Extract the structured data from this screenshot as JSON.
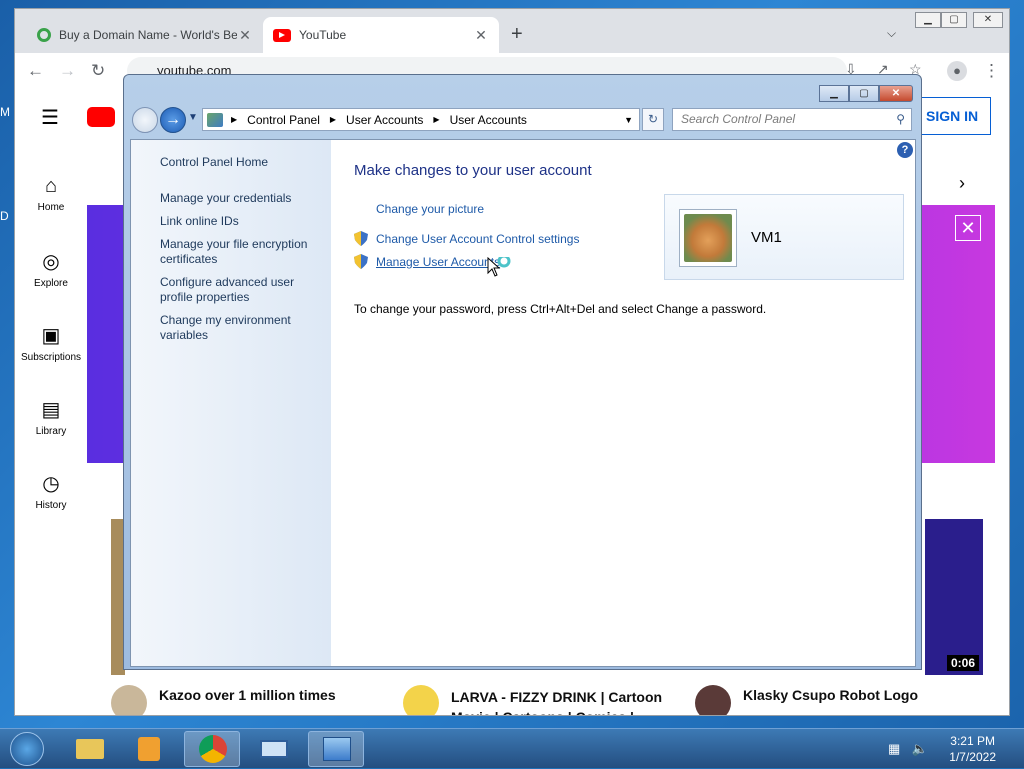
{
  "desktop": {
    "edge_letters": [
      "M",
      "D"
    ]
  },
  "browser": {
    "tabs": [
      {
        "title": "Buy a Domain Name - World's Be",
        "icon": "namecheap-icon"
      },
      {
        "title": "YouTube",
        "icon": "youtube-icon",
        "active": true
      }
    ],
    "new_tab_icon": "plus-icon",
    "url": "youtube.com",
    "window_buttons": [
      "minimize",
      "maximize",
      "close"
    ]
  },
  "youtube": {
    "sign_in": "SIGN IN",
    "sidebar": [
      {
        "label": "Home",
        "icon": "home-icon"
      },
      {
        "label": "Explore",
        "icon": "compass-icon"
      },
      {
        "label": "Subscriptions",
        "icon": "subscriptions-icon"
      },
      {
        "label": "Library",
        "icon": "library-icon"
      },
      {
        "label": "History",
        "icon": "history-icon"
      }
    ],
    "videos": [
      {
        "title": "Kazoo over 1 million times"
      },
      {
        "title": "LARVA - FIZZY DRINK | Cartoon Movie | Cartoons | Comics |"
      },
      {
        "title": "Klasky Csupo Robot Logo"
      }
    ],
    "duration": "0:06"
  },
  "control_panel": {
    "breadcrumb": [
      "Control Panel",
      "User Accounts",
      "User Accounts"
    ],
    "search_placeholder": "Search Control Panel",
    "left_links": [
      "Control Panel Home",
      "Manage your credentials",
      "Link online IDs",
      "Manage your file encryption certificates",
      "Configure advanced user profile properties",
      "Change my environment variables"
    ],
    "heading": "Make changes to your user account",
    "tasks": [
      {
        "label": "Change your picture",
        "shield": false
      },
      {
        "label": "Change User Account Control settings",
        "shield": true
      },
      {
        "label": "Manage User Accounts",
        "shield": true
      }
    ],
    "account_name": "VM1",
    "password_note": "To change your password, press Ctrl+Alt+Del and select Change a password."
  },
  "taskbar": {
    "apps": [
      "explorer-icon",
      "media-player-icon",
      "chrome-icon",
      "remote-desktop-icon",
      "control-panel-icon"
    ],
    "time": "3:21 PM",
    "date": "1/7/2022"
  }
}
